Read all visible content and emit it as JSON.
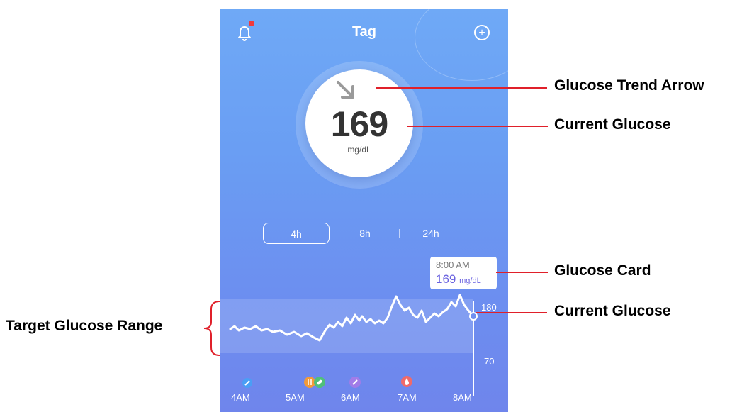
{
  "header": {
    "title": "Tag"
  },
  "reading": {
    "value": "169",
    "unit": "mg/dL"
  },
  "range_tabs": [
    {
      "label": "4h",
      "active": true
    },
    {
      "label": "8h",
      "active": false
    },
    {
      "label": "24h",
      "active": false
    }
  ],
  "glucose_card": {
    "time": "8:00 AM",
    "value": "169",
    "unit": "mg/dL"
  },
  "chart": {
    "y_labels": {
      "upper": "180",
      "lower": "70"
    },
    "x_labels": [
      "4AM",
      "5AM",
      "6AM",
      "7AM",
      "8AM"
    ],
    "event_icons": [
      "insulin-icon",
      "food-icon",
      "pill-icon",
      "exercise-icon",
      "blood-drop-icon"
    ]
  },
  "annotations": {
    "trend_arrow": "Glucose Trend Arrow",
    "current_glucose_top": "Current Glucose",
    "glucose_card": "Glucose Card",
    "current_glucose_bottom": "Current Glucose",
    "target_range": "Target Glucose Range"
  },
  "colors": {
    "accent": "#6b63e0",
    "annotation_line": "#e0202a",
    "bell_dot": "#f23a3a"
  }
}
